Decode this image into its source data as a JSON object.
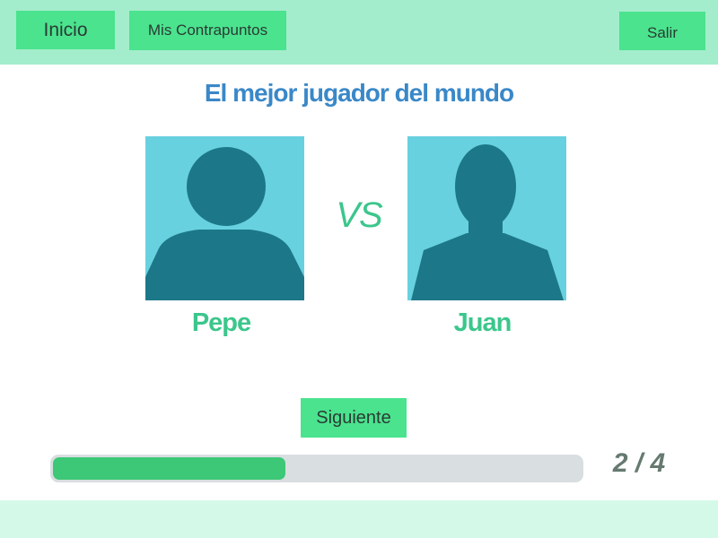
{
  "colors": {
    "topbar": "#a3edcc",
    "button": "#4be38e",
    "title": "#3a88c8",
    "accent_green": "#3cc68c",
    "avatar_bg": "#68d1df",
    "avatar_silhouette": "#1c7888",
    "progress_track": "#d9dee0",
    "progress_fill": "#3cc876",
    "progress_text": "#667a70",
    "footer": "#d5f9e8"
  },
  "nav": {
    "inicio_label": "Inicio",
    "contrapuntos_label": "Mis Contrapuntos",
    "salir_label": "Salir"
  },
  "main": {
    "title": "El mejor jugador del mundo",
    "vs_label": "VS",
    "players": [
      {
        "name": "Pepe",
        "icon": "user-avatar-icon"
      },
      {
        "name": "Juan",
        "icon": "user-avatar-icon"
      }
    ],
    "next_label": "Siguiente"
  },
  "progress": {
    "current": 2,
    "total": 4,
    "label": "2 / 4",
    "fill_fraction": 0.44
  }
}
